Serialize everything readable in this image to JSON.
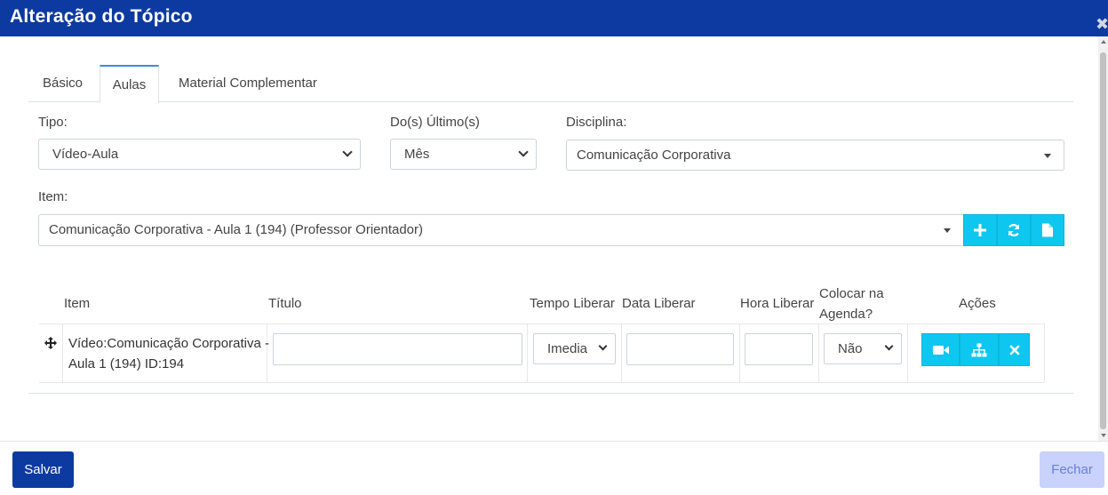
{
  "header": {
    "title": "Alteração do Tópico",
    "close_glyph": "✖"
  },
  "tabs": [
    {
      "label": "Básico",
      "active": false
    },
    {
      "label": "Aulas",
      "active": true
    },
    {
      "label": "Material Complementar",
      "active": false
    }
  ],
  "form": {
    "tipo": {
      "label": "Tipo:",
      "value": "Vídeo-Aula"
    },
    "ultimos": {
      "label": "Do(s) Último(s)",
      "value": "Mês"
    },
    "disciplina": {
      "label": "Disciplina:",
      "value": "Comunicação Corporativa"
    },
    "item": {
      "label": "Item:",
      "value": "Comunicação Corporativa - Aula 1 (194) (Professor Orientador)"
    },
    "item_buttons": [
      "plus-icon",
      "refresh-icon",
      "file-icon"
    ]
  },
  "table": {
    "headers": {
      "item": "Item",
      "titulo": "Título",
      "tempo_liberar": "Tempo Liberar",
      "data_liberar": "Data Liberar",
      "hora_liberar": "Hora Liberar",
      "agenda_line1": "Colocar na",
      "agenda_line2": "Agenda?",
      "acoes": "Ações"
    },
    "rows": [
      {
        "item_line1": "Vídeo:Comunicação Corporativa -",
        "item_line2": "Aula 1 (194) ID:194",
        "titulo": "",
        "tempo_liberar": "Imedia",
        "data_liberar": "",
        "hora_liberar": "",
        "agenda": "Não",
        "actions": [
          "video-icon",
          "sitemap-icon",
          "close-icon"
        ]
      }
    ]
  },
  "footer": {
    "save_label": "Salvar",
    "close_label": "Fechar"
  },
  "colors": {
    "header_bg": "#0d3aa0",
    "accent_cyan": "#0ec7f0",
    "tab_active_border": "#3a8fd9",
    "close_btn_bg": "#c9d2fb"
  }
}
